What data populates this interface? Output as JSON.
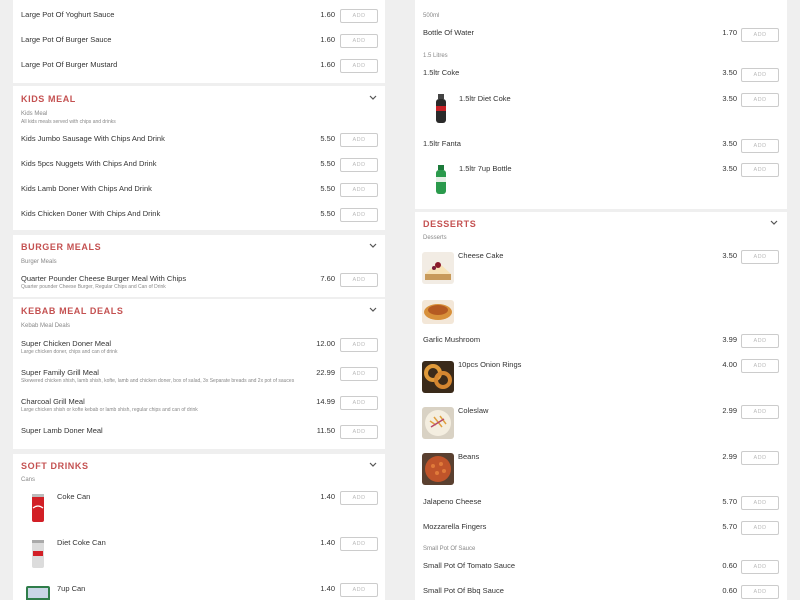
{
  "add_label": "ADD",
  "left": {
    "sauces": [
      {
        "name": "Large Pot Of Yoghurt Sauce",
        "price": "1.60"
      },
      {
        "name": "Large Pot Of Burger Sauce",
        "price": "1.60"
      },
      {
        "name": "Large Pot Of Burger Mustard",
        "price": "1.60"
      }
    ],
    "kids": {
      "title": "KIDS MEAL",
      "sub": "Kids Meal",
      "sub_desc": "All kids meals served with chips and drinks",
      "items": [
        {
          "name": "Kids Jumbo Sausage With Chips And Drink",
          "price": "5.50"
        },
        {
          "name": "Kids 5pcs Nuggets With Chips And Drink",
          "price": "5.50"
        },
        {
          "name": "Kids Lamb Doner With Chips And Drink",
          "price": "5.50"
        },
        {
          "name": "Kids Chicken Doner With Chips And Drink",
          "price": "5.50"
        }
      ]
    },
    "burger": {
      "title": "BURGER MEALS",
      "sub": "Burger Meals",
      "items": [
        {
          "name": "Quarter Pounder Cheese Burger Meal With Chips",
          "desc": "Quarter pounder Cheese Burger, Regular Chips and Can of Drink",
          "price": "7.60"
        }
      ]
    },
    "kebab": {
      "title": "KEBAB MEAL DEALS",
      "sub": "Kebab Meal Deals",
      "items": [
        {
          "name": "Super Chicken Doner Meal",
          "desc": "Large chicken doner, chips and can of drink",
          "price": "12.00"
        },
        {
          "name": "Super Family Grill Meal",
          "desc": "Skewered chicken shish, lamb shish, kofte, lamb and chicken doner, box of salad, 3x Separate breads and 2x pot of sauces",
          "price": "22.99"
        },
        {
          "name": "Charcoal Grill Meal",
          "desc": "Large chicken shish or kofte kebab or lamb shish, regular chips and can of drink",
          "price": "14.99"
        },
        {
          "name": "Super Lamb Doner Meal",
          "desc": "",
          "price": "11.50"
        }
      ]
    },
    "drinks": {
      "title": "SOFT DRINKS",
      "sub": "Cans",
      "items": [
        {
          "name": "Coke Can",
          "price": "1.40"
        },
        {
          "name": "Diet Coke Can",
          "price": "1.40"
        },
        {
          "name": "7up Can",
          "price": "1.40"
        }
      ]
    }
  },
  "right": {
    "water_sub": "500ml",
    "water": {
      "name": "Bottle Of Water",
      "price": "1.70"
    },
    "litre_sub": "1.5 Litres",
    "litre_items": [
      {
        "name": "1.5ltr Coke",
        "price": "3.50"
      },
      {
        "name": "1.5ltr Diet Coke",
        "price": "3.50"
      },
      {
        "name": "1.5ltr Fanta",
        "price": "3.50"
      },
      {
        "name": "1.5ltr 7up Bottle",
        "price": "3.50"
      }
    ],
    "desserts": {
      "title": "DESSERTS",
      "sub": "Desserts",
      "items": [
        {
          "name": "Cheese Cake",
          "price": "3.50"
        }
      ]
    },
    "sides": [
      {
        "name": "Garlic Mushroom",
        "price": "3.99"
      },
      {
        "name": "10pcs Onion Rings",
        "price": "4.00"
      },
      {
        "name": "Coleslaw",
        "price": "2.99"
      },
      {
        "name": "Beans",
        "price": "2.99"
      },
      {
        "name": "Jalapeno Cheese",
        "price": "5.70"
      },
      {
        "name": "Mozzarella Fingers",
        "price": "5.70"
      }
    ],
    "small_sub": "Small Pot Of Sauce",
    "small_sauces": [
      {
        "name": "Small Pot Of Tomato Sauce",
        "price": "0.60"
      },
      {
        "name": "Small Pot Of Bbq Sauce",
        "price": "0.60"
      }
    ]
  }
}
